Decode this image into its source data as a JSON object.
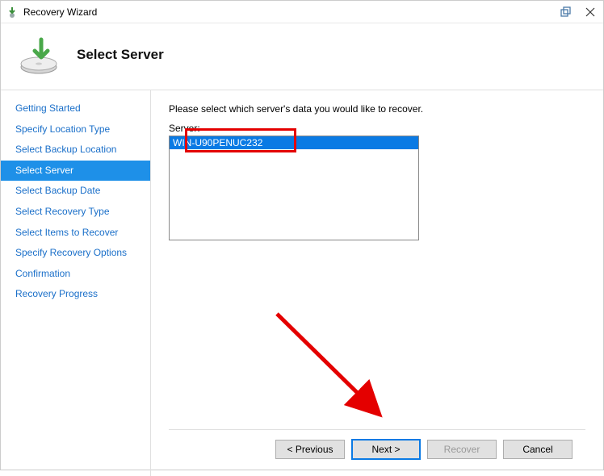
{
  "window": {
    "title": "Recovery Wizard"
  },
  "header": {
    "title": "Select Server"
  },
  "sidebar": {
    "steps": [
      {
        "label": "Getting Started"
      },
      {
        "label": "Specify Location Type"
      },
      {
        "label": "Select Backup Location"
      },
      {
        "label": "Select Server"
      },
      {
        "label": "Select Backup Date"
      },
      {
        "label": "Select Recovery Type"
      },
      {
        "label": "Select Items to Recover"
      },
      {
        "label": "Specify Recovery Options"
      },
      {
        "label": "Confirmation"
      },
      {
        "label": "Recovery Progress"
      }
    ],
    "active_index": 3
  },
  "main": {
    "instruction": "Please select which server's data you would like to recover.",
    "server_label": "Server:",
    "servers": [
      "WIN-U90PENUC232"
    ],
    "selected_server_index": 0
  },
  "footer": {
    "previous": "< Previous",
    "next": "Next >",
    "recover": "Recover",
    "cancel": "Cancel"
  }
}
